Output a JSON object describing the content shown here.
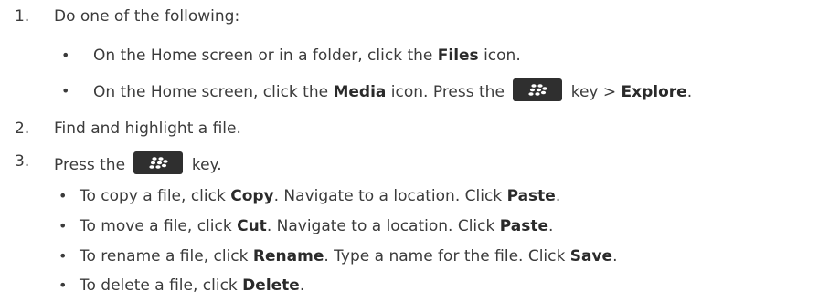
{
  "steps": [
    {
      "number": "1.",
      "text": "Do one of the following:",
      "options": [
        {
          "bullet": "•",
          "prefix": "On the Home screen or in a folder, click the ",
          "bold": "Files",
          "suffix": " icon."
        },
        {
          "bullet": "•",
          "prefix": "On the Home screen, click the ",
          "bold": "Media",
          "middle": " icon. Press the ",
          "key_icon": "blackberry-menu-key-icon",
          "after_key": " key > ",
          "bold2": "Explore",
          "suffix": "."
        }
      ]
    },
    {
      "number": "2.",
      "text": "Find and highlight a file."
    },
    {
      "number": "3.",
      "prefix": "Press the ",
      "key_icon": "blackberry-menu-key-icon",
      "suffix": " key.",
      "actions": [
        {
          "bullet": "•",
          "p1": "To copy a file, click ",
          "b1": "Copy",
          "p2": ". Navigate to a location. Click ",
          "b2": "Paste",
          "p3": "."
        },
        {
          "bullet": "•",
          "p1": "To move a file, click ",
          "b1": "Cut",
          "p2": ". Navigate to a location. Click ",
          "b2": "Paste",
          "p3": "."
        },
        {
          "bullet": "•",
          "p1": "To rename a file, click ",
          "b1": "Rename",
          "p2": ". Type a name for the file. Click ",
          "b2": "Save",
          "p3": "."
        },
        {
          "bullet": "•",
          "p1": "To delete a file, click ",
          "b1": "Delete",
          "p2": ".",
          "b2": "",
          "p3": ""
        }
      ]
    }
  ],
  "colors": {
    "text": "#3b3b3b",
    "key_bg": "#2f2f2f",
    "key_glyph": "#ffffff"
  }
}
